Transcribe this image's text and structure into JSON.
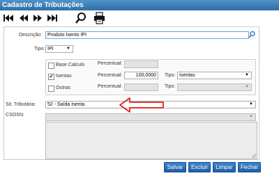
{
  "window": {
    "title": "Cadastro de Tributações"
  },
  "toolbar": {
    "icons": [
      "first-record-icon",
      "previous-record-icon",
      "next-record-icon",
      "last-record-icon",
      "search-icon",
      "print-icon"
    ]
  },
  "form": {
    "descricao": {
      "label": "Descrição:",
      "value": "Produto Isento IPI"
    },
    "tipo": {
      "label": "Tipo:",
      "value": "IPI"
    },
    "base_calculo": {
      "label": "Base Calculo",
      "checked": false,
      "percentual_label": "Percentual:"
    },
    "isentas": {
      "label": "Isentas",
      "checked": true,
      "percentual_label": "Percentual:",
      "percentual_value": "100,0000",
      "tipo_label": "Tipo:",
      "tipo_value": "Isentas"
    },
    "outras": {
      "label": "Outras",
      "checked": false,
      "percentual_label": "Percentual:",
      "tipo_label": "Tipo:"
    },
    "sit_tributaria": {
      "label": "Sit. Tributária:",
      "value": "52 - Saída Isenta"
    },
    "csosn": {
      "label": "CSOSN:"
    }
  },
  "buttons": {
    "salvar": "Salvar",
    "excluir": "Excluir",
    "limpar": "Limpar",
    "fechar": "Fechar"
  },
  "colors": {
    "titlebar": "#3b7fbd",
    "button": "#2a6fb8",
    "annotation_arrow": "#e02020"
  }
}
